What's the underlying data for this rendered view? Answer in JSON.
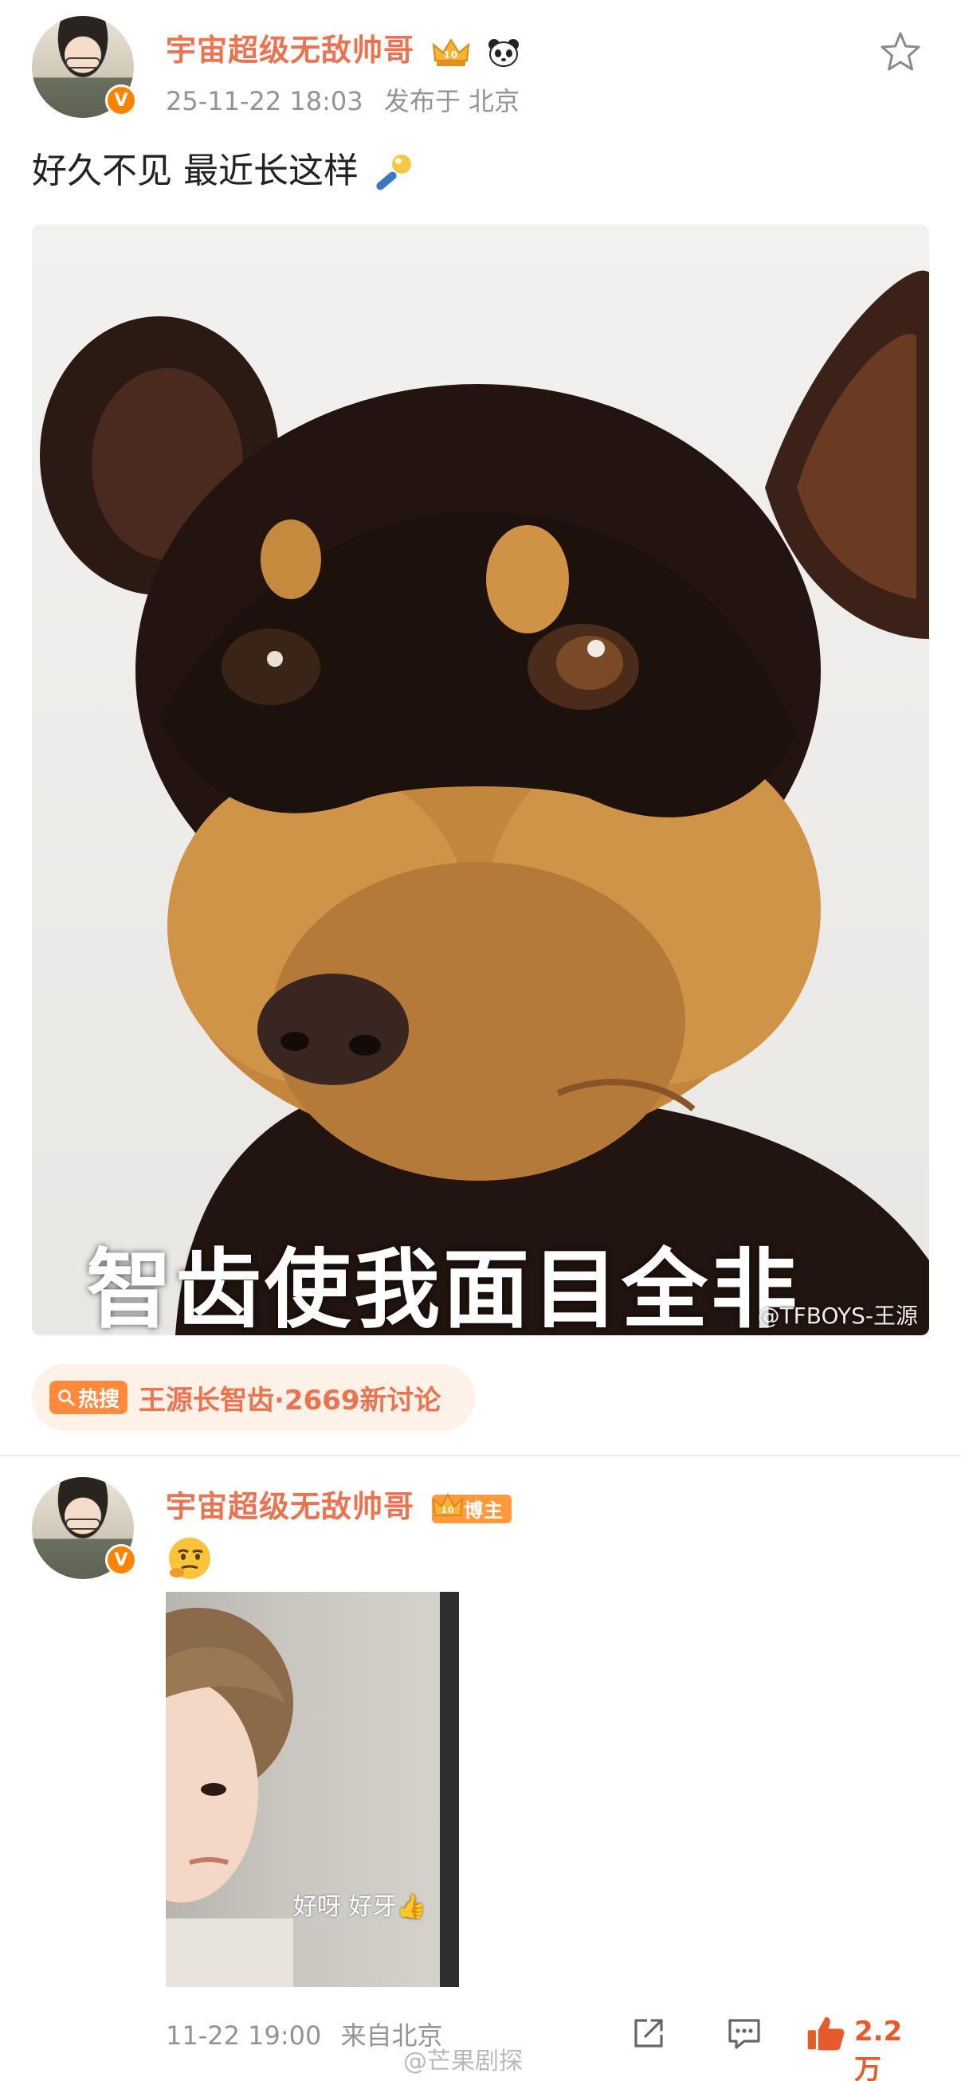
{
  "post": {
    "author": "宇宙超级无敌帅哥",
    "timestamp": "25-11-22 18:03",
    "location": "发布于 北京",
    "text": "好久不见 最近长这样",
    "image_caption": "智齿使我面目全非",
    "image_watermark": "@TFBOYS-王源",
    "hot_topic": {
      "pill": "热搜",
      "text": "王源长智齿·2669新讨论"
    }
  },
  "reply": {
    "author": "宇宙超级无敌帅哥",
    "badge": "博主",
    "photo_caption": "好呀 好牙👍",
    "time": "11-22 19:00",
    "source": "来自北京",
    "likes": "2.2万"
  },
  "footer_watermark": "@芒果剧探",
  "colors": {
    "username": "#eb7350",
    "meta": "#939393",
    "verified": "#ff8200",
    "like": "#e65b2b",
    "hot_bg": "#fdf1e8"
  },
  "icons": {
    "verified": "verified-v-icon",
    "favorite": "star-outline-icon",
    "share": "share-icon",
    "comment": "comment-icon",
    "like": "thumbs-up-icon"
  }
}
